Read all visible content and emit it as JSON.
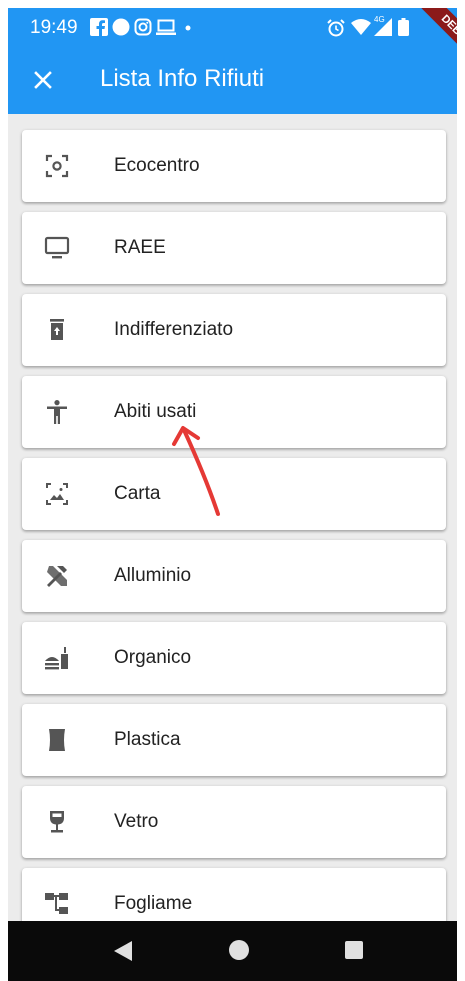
{
  "status_bar": {
    "time": "19:49",
    "network_label": "4G",
    "icons": [
      "facebook-icon",
      "circle-icon",
      "instagram-icon",
      "laptop-icon",
      "dot-icon",
      "alarm-icon",
      "wifi-icon",
      "signal-icon",
      "battery-icon"
    ]
  },
  "app_bar": {
    "title": "Lista Info Rifiuti",
    "close_icon": "close-icon",
    "background": "#2196f3"
  },
  "debug_banner": "DEBUG",
  "items": [
    {
      "label": "Ecocentro",
      "icon": "center-focus-icon"
    },
    {
      "label": "RAEE",
      "icon": "monitor-icon"
    },
    {
      "label": "Indifferenziato",
      "icon": "trash-bin-icon"
    },
    {
      "label": "Abiti usati",
      "icon": "person-icon"
    },
    {
      "label": "Carta",
      "icon": "photo-size-icon"
    },
    {
      "label": "Alluminio",
      "icon": "tools-icon"
    },
    {
      "label": "Organico",
      "icon": "food-icon"
    },
    {
      "label": "Plastica",
      "icon": "container-icon"
    },
    {
      "label": "Vetro",
      "icon": "wine-glass-icon"
    },
    {
      "label": "Fogliame",
      "icon": "tree-structure-icon"
    }
  ],
  "annotation": {
    "color": "#e53935",
    "kind": "red-arrow"
  },
  "nav": {
    "icons": [
      "back-icon",
      "home-icon",
      "recents-icon"
    ]
  }
}
